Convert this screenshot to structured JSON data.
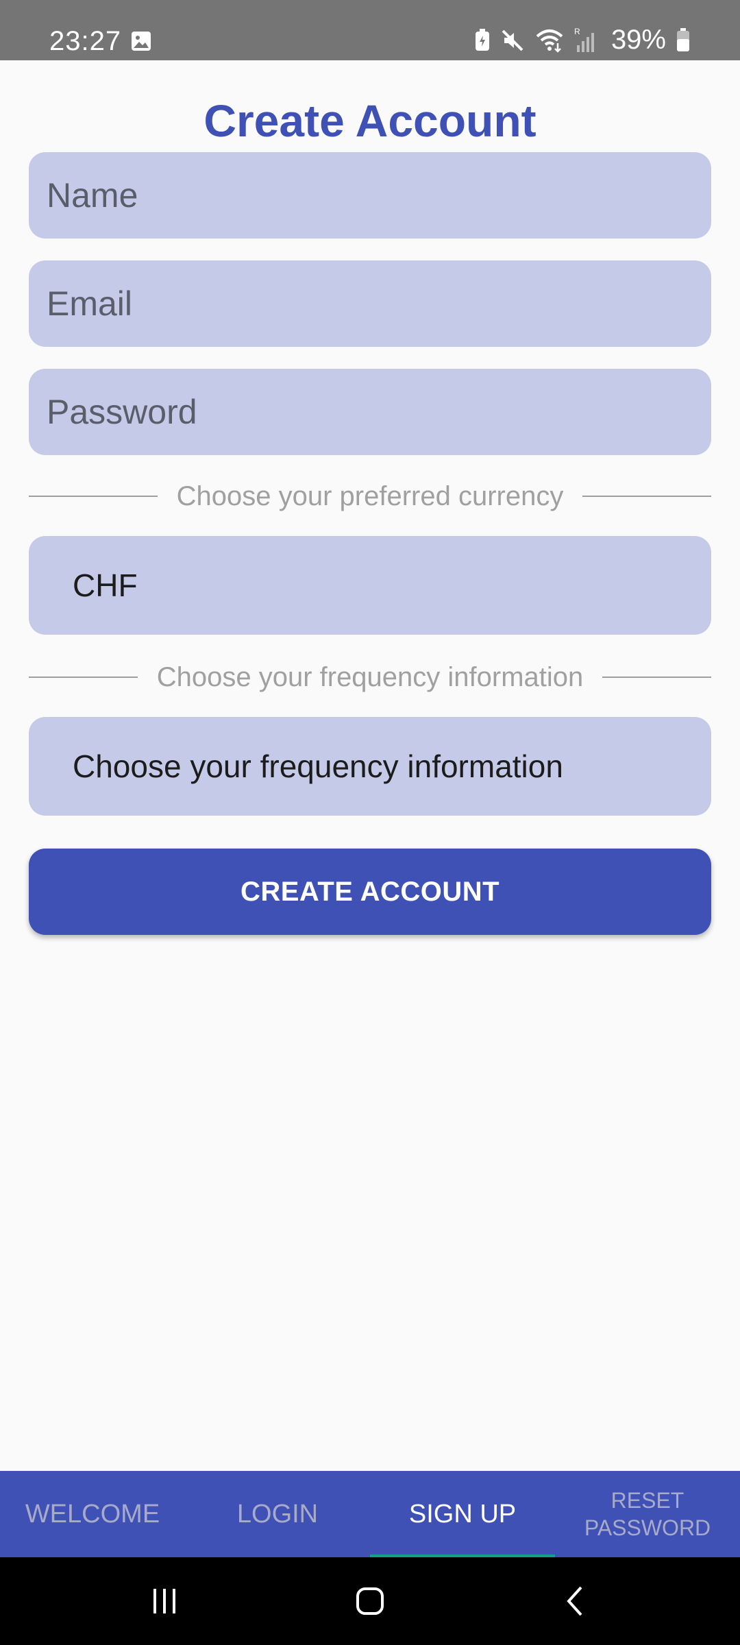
{
  "status_bar": {
    "time": "23:27",
    "battery": "39%",
    "icons": [
      "gallery-icon",
      "battery-saver-icon",
      "mute-icon",
      "wifi-icon",
      "signal-icon",
      "battery-icon"
    ]
  },
  "form": {
    "title": "Create Account",
    "name_placeholder": "Name",
    "email_placeholder": "Email",
    "password_placeholder": "Password",
    "currency_divider": "Choose your preferred currency",
    "currency_value": "CHF",
    "frequency_divider": "Choose your frequency information",
    "frequency_value": "Choose your frequency information",
    "submit_label": "CREATE ACCOUNT"
  },
  "tabs": [
    {
      "label": "WELCOME",
      "active": false
    },
    {
      "label": "LOGIN",
      "active": false
    },
    {
      "label": "SIGN UP",
      "active": true
    },
    {
      "label": "RESET PASSWORD",
      "active": false
    }
  ],
  "system_nav": {
    "icons": [
      "recents-icon",
      "home-icon",
      "back-icon"
    ]
  },
  "colors": {
    "primary": "#3f51b5",
    "field_background": "#c5cae9",
    "status_bar": "#757575",
    "tab_indicator": "#12a08a"
  }
}
